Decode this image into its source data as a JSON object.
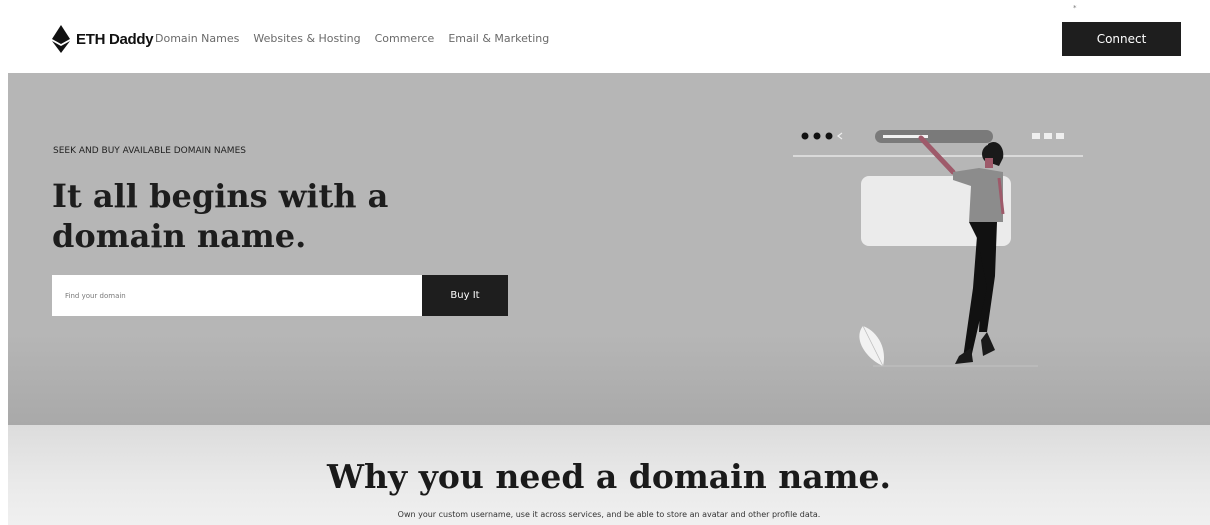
{
  "nav": {
    "brand": "ETH Daddy",
    "links": [
      "Domain Names",
      "Websites & Hosting",
      "Commerce",
      "Email & Marketing"
    ],
    "connect_label": "Connect",
    "corner_mark": "*"
  },
  "hero": {
    "eyebrow": "SEEK AND BUY AVAILABLE DOMAIN NAMES",
    "headline": "It all begins with a domain name.",
    "search": {
      "placeholder": "Find your domain",
      "value": ""
    },
    "buy_label": "Buy It"
  },
  "why": {
    "title": "Why you need a domain name.",
    "subtitle": "Own your custom username, use it across services, and be able to store an avatar and other profile data."
  },
  "colors": {
    "hero_bg": "#b6b6b6",
    "dark_button": "#1e1e1e",
    "accent": "#9e5a6a"
  }
}
